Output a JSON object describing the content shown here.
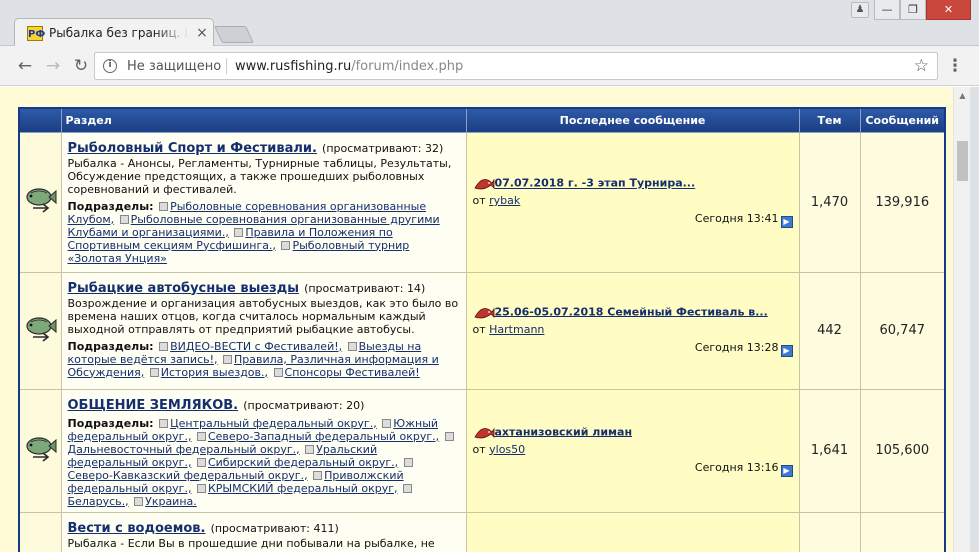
{
  "browser": {
    "tab_favicon": "РФ",
    "tab_title": "Рыбалка без границ. Це",
    "tab_close": "×",
    "security_label": "Не защищено",
    "url_host": "www.rusfishing.ru",
    "url_path": "/forum/index.php",
    "icons": [
      "back-icon",
      "forward-icon",
      "reload-icon",
      "info-icon",
      "star-icon",
      "menu-icon",
      "minimize-icon",
      "maximize-icon",
      "close-icon",
      "user-icon"
    ]
  },
  "table": {
    "headers": {
      "section": "Раздел",
      "last_post": "Последнее сообщение",
      "topics": "Тем",
      "posts": "Сообщений"
    },
    "subsections_label": "Подразделы:",
    "from_label": "от",
    "forums": [
      {
        "title": "Рыболовный Спорт и Фестивали.",
        "viewing": "(просматривают: 32)",
        "description": "Рыбалка - Анонсы, Регламенты, Турнирные таблицы, Результаты, Обсуждение предстоящих, а также прошедших рыболовных соревнований и фестивалей.",
        "subsections": [
          "Рыболовные соревнования организованные Клубом,",
          "Рыболовные соревнования организованные другими Клубами и организациями.,",
          "Правила и Положения по Спортивным секциям Русфишинга.,",
          "Рыболовный турнир «Золотая Унция»"
        ],
        "last_title": "07.07.2018 г. -3 этап Турнира...",
        "last_author": "rybak",
        "last_date": "Сегодня",
        "last_time": "13:41",
        "topics": "1,470",
        "posts": "139,916"
      },
      {
        "title": "Рыбацкие автобусные выезды",
        "viewing": "(просматривают: 14)",
        "description": "Возрождение и организация автобусных выездов, как это было во времена наших отцов, когда считалось нормальным каждый выходной отправлять от предприятий рыбацкие автобусы.",
        "subsections": [
          "ВИДЕО-ВЕСТИ с Фестивалей!,",
          "Выезды на которые ведётся запись!,",
          "Правила, Различная информация и Обсуждения,",
          "История выездов.,",
          "Спонсоры Фестивалей!"
        ],
        "last_title": "25.06-05.07.2018 Семейный Фестиваль в...",
        "last_author": "Hartmann",
        "last_date": "Сегодня",
        "last_time": "13:28",
        "topics": "442",
        "posts": "60,747"
      },
      {
        "title": "ОБЩЕНИЕ ЗЕМЛЯКОВ.",
        "viewing": "(просматривают: 20)",
        "description": "",
        "subsections": [
          "Центральный федеральный округ.,",
          "Южный федеральный округ.,",
          "Северо-Западный федеральный округ.,",
          "Дальневосточный федеральный округ.,",
          "Уральский федеральный округ.,",
          "Сибирский федеральный округ.,",
          "Северо-Кавказский федеральный округ.,",
          "Приволжский федеральный округ.,",
          "КРЫМСКИЙ федеральный округ,",
          "Беларусь.,",
          "Украина."
        ],
        "last_title": "ахтанизовский лиман",
        "last_author": "ylos50",
        "last_date": "Сегодня",
        "last_time": "13:16",
        "topics": "1,641",
        "posts": "105,600"
      },
      {
        "title": "Вести с водоемов.",
        "viewing": "(просматривают: 411)",
        "description": "Рыбалка - Если Вы в прошедшие дни побывали на рыбалке, не",
        "subsections": [],
        "last_title": "",
        "last_author": "",
        "last_date": "",
        "last_time": "",
        "topics": "",
        "posts": ""
      }
    ]
  },
  "colors": {
    "header_blue": "#1b3e84",
    "link_blue": "#152e6e",
    "page_bg": "#fffbd7",
    "last_post_bg": "#fffdc4"
  }
}
